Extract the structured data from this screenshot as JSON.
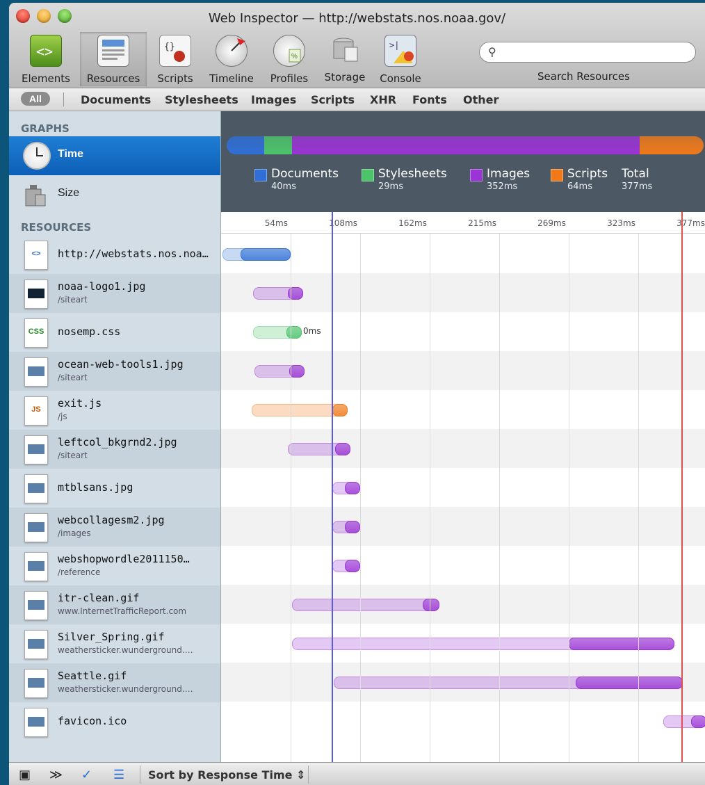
{
  "window": {
    "title": "Web Inspector — http://webstats.nos.noaa.gov/"
  },
  "toolbar": {
    "items": [
      {
        "label": "Elements",
        "icon": "elements-icon"
      },
      {
        "label": "Resources",
        "icon": "resources-icon",
        "selected": true
      },
      {
        "label": "Scripts",
        "icon": "scripts-icon"
      },
      {
        "label": "Timeline",
        "icon": "timeline-icon"
      },
      {
        "label": "Profiles",
        "icon": "profiles-icon"
      },
      {
        "label": "Storage",
        "icon": "storage-icon"
      },
      {
        "label": "Console",
        "icon": "console-icon"
      }
    ],
    "search_label": "Search Resources",
    "search_value": ""
  },
  "filters": {
    "all": "All",
    "items": [
      "Documents",
      "Stylesheets",
      "Images",
      "Scripts",
      "XHR",
      "Fonts",
      "Other"
    ]
  },
  "sidebar": {
    "graphs_heading": "GRAPHS",
    "graphs": [
      {
        "label": "Time",
        "selected": true
      },
      {
        "label": "Size"
      }
    ],
    "resources_heading": "RESOURCES",
    "resources": [
      {
        "name": "http://webstats.nos.noa…",
        "sub": ""
      },
      {
        "name": "noaa-logo1.jpg",
        "sub": "/siteart"
      },
      {
        "name": "nosemp.css",
        "sub": ""
      },
      {
        "name": "ocean-web-tools1.jpg",
        "sub": "/siteart"
      },
      {
        "name": "exit.js",
        "sub": "/js"
      },
      {
        "name": "leftcol_bkgrnd2.jpg",
        "sub": "/siteart"
      },
      {
        "name": "mtblsans.jpg",
        "sub": ""
      },
      {
        "name": "webcollagesm2.jpg",
        "sub": "/images"
      },
      {
        "name": "webshopwordle2011150…",
        "sub": "/reference"
      },
      {
        "name": "itr-clean.gif",
        "sub": "www.InternetTrafficReport.com"
      },
      {
        "name": "Silver_Spring.gif",
        "sub": "weathersticker.wunderground.…"
      },
      {
        "name": "Seattle.gif",
        "sub": "weathersticker.wunderground.…"
      },
      {
        "name": "favicon.ico",
        "sub": ""
      }
    ]
  },
  "summary": {
    "legend": [
      {
        "name": "Documents",
        "value": "40ms",
        "color": "#2f6fd6"
      },
      {
        "name": "Stylesheets",
        "value": "29ms",
        "color": "#4cc46a"
      },
      {
        "name": "Images",
        "value": "352ms",
        "color": "#9a34d4"
      },
      {
        "name": "Scripts",
        "value": "64ms",
        "color": "#f07a1a"
      }
    ],
    "total_label": "Total",
    "total_value": "377ms"
  },
  "timeline": {
    "ticks": [
      "54ms",
      "108ms",
      "162ms",
      "215ms",
      "269ms",
      "323ms",
      "377ms"
    ],
    "css_annotation": "0ms"
  },
  "bottom": {
    "sort_label": "Sort by Response Time"
  },
  "colors": {
    "doc": "#2f6fd6",
    "css": "#4cc46a",
    "img": "#9a34d4",
    "script": "#f07a1a",
    "dom_line": "#5b5bd6",
    "load_line": "#e05050"
  }
}
